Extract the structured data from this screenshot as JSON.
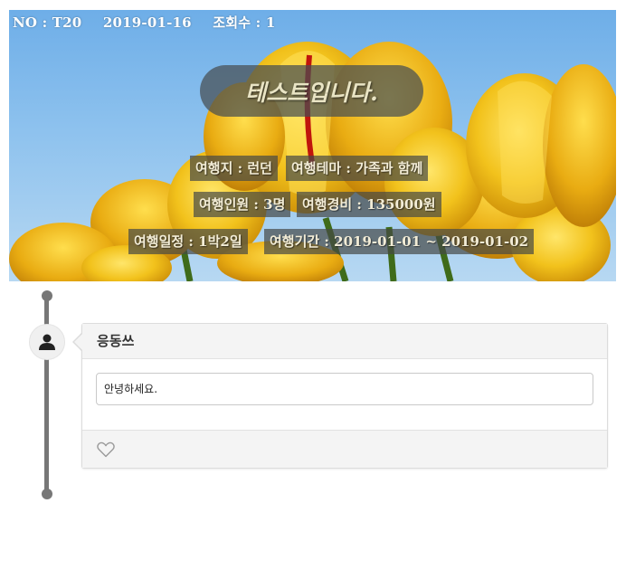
{
  "post": {
    "no": "NO : T20",
    "date": "2019-01-16",
    "views": "조회수 : 1",
    "title": "테스트입니다.",
    "tags": {
      "destination": "여행지 : 런던",
      "theme": "여행테마 : 가족과 함께",
      "people": "여행인원 : 3명",
      "cost": "여행경비 : 135000원",
      "schedule": "여행일정 : 1박2일",
      "period": "여행기간 : 2019-01-01 ~ 2019-01-02"
    }
  },
  "comment": {
    "author": "응동쓰",
    "text": "안녕하세요."
  },
  "icons": {
    "avatar": "user-icon",
    "like": "heart-outline-icon"
  },
  "colors": {
    "timeline": "#777777",
    "tulip": "#f2c21c",
    "sky": "#6eaee8"
  }
}
